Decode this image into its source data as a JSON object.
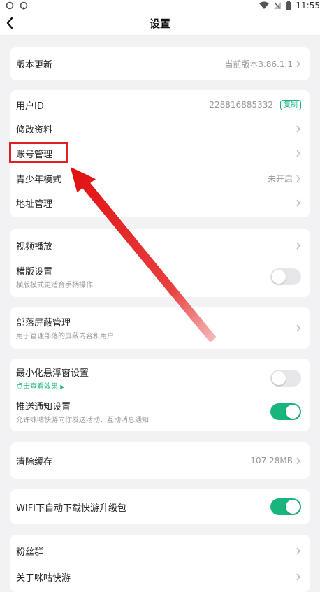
{
  "status_bar": {
    "time": "11:55"
  },
  "nav": {
    "title": "设置"
  },
  "version_card": {
    "label": "版本更新",
    "value": "当前版本3.86.1.1"
  },
  "account_card": {
    "user_id_label": "用户ID",
    "user_id_value": "228816885332",
    "copy_label": "复制",
    "edit_profile_label": "修改资料",
    "account_manage_label": "账号管理",
    "youth_mode_label": "青少年模式",
    "youth_mode_value": "未开启",
    "address_label": "地址管理"
  },
  "video_card": {
    "video_play_label": "视频播放",
    "landscape_label": "横版设置",
    "landscape_sub": "横版模式更适合手柄操作",
    "landscape_on": false
  },
  "tribe_card": {
    "label": "部落屏蔽管理",
    "sub": "用于管理部落的屏蔽内容和用户"
  },
  "float_card": {
    "float_label": "最小化悬浮窗设置",
    "float_sub": "点击查看效果",
    "float_on": false,
    "push_label": "推送通知设置",
    "push_sub": "允许咪咕快游向你发送活动、互动消息通知",
    "push_on": true
  },
  "cache_card": {
    "label": "清除缓存",
    "value": "107.28MB"
  },
  "wifi_card": {
    "label": "WIFI下自动下载快游升级包",
    "on": true
  },
  "more_card": {
    "fans_label": "粉丝群",
    "about_label": "关于咪咕快游"
  },
  "colors": {
    "accent": "#18b67c",
    "annotation": "#e02020"
  }
}
